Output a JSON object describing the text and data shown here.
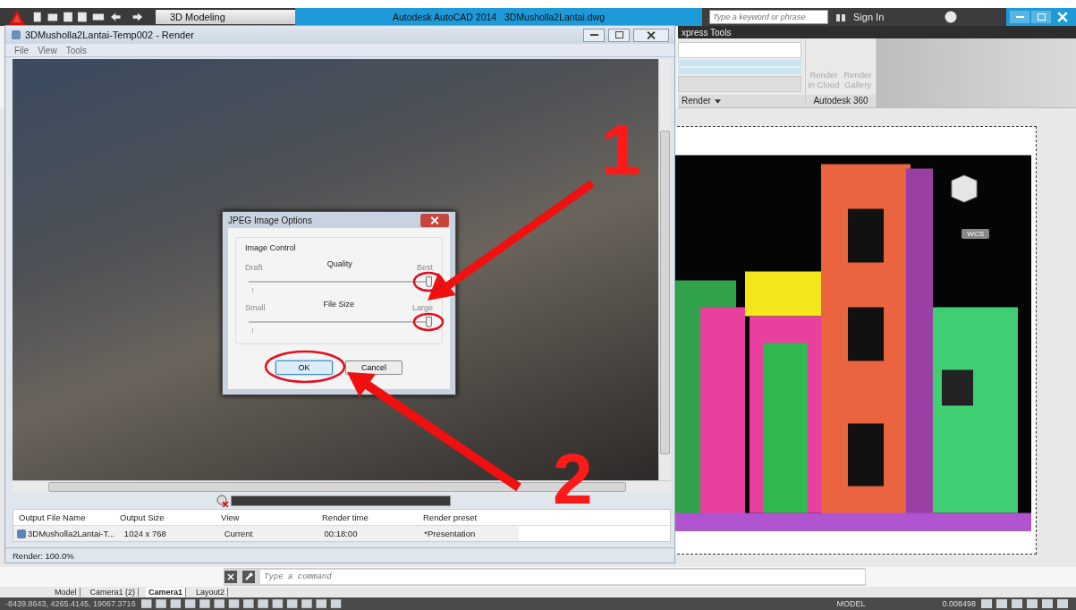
{
  "app": {
    "workspace": "3D Modeling",
    "title": "Autodesk AutoCAD 2014",
    "file": "3DMusholla2Lantai.dwg",
    "search_placeholder": "Type a keyword or phrase",
    "sign_in": "Sign In"
  },
  "ribbon": {
    "tab": "xpress Tools",
    "panel_title": "Render",
    "buttons": [
      {
        "label": "Render in Cloud"
      },
      {
        "label": "Render Gallery"
      }
    ],
    "panel_2_title": "Autodesk 360"
  },
  "viewport": {
    "ucs_label": "WCS"
  },
  "render_window": {
    "title": "3DMusholla2Lantai-Temp002 - Render",
    "menu": [
      "File",
      "View",
      "Tools"
    ],
    "columns": [
      "Output File Name",
      "Output Size",
      "View",
      "Render time",
      "Render preset"
    ],
    "rows": [
      {
        "cells": [
          "3DMusholla2Lantai-T...",
          "1024 x 768",
          "Current",
          "00:18:00",
          "*Presentation"
        ]
      }
    ],
    "status": "Render: 100.0%",
    "progress": {
      "level": 1
    }
  },
  "dialog": {
    "title": "JPEG Image Options",
    "group": "Image Control",
    "sliders": [
      {
        "label": "Quality",
        "min_label": "Draft",
        "max_label": "Best",
        "level": 1
      },
      {
        "label": "File Size",
        "min_label": "Small",
        "max_label": "Large",
        "level": 1
      }
    ],
    "buttons": [
      {
        "label": "OK",
        "selected": true
      },
      {
        "label": "Cancel",
        "selected": false
      }
    ]
  },
  "annotations": [
    {
      "label": "1"
    },
    {
      "label": "2"
    }
  ],
  "command_line": {
    "placeholder": "Type a command"
  },
  "layout_tabs": [
    {
      "label": "Model",
      "selected": false
    },
    {
      "label": "Camera1 (2)",
      "selected": false
    },
    {
      "label": "Camera1",
      "selected": true
    },
    {
      "label": "Layout2",
      "selected": false
    }
  ],
  "status_bar": {
    "coordinates": "-8439.8643, 4265.4145, 19067.3716",
    "space": "MODEL",
    "scale": "0.008498"
  }
}
